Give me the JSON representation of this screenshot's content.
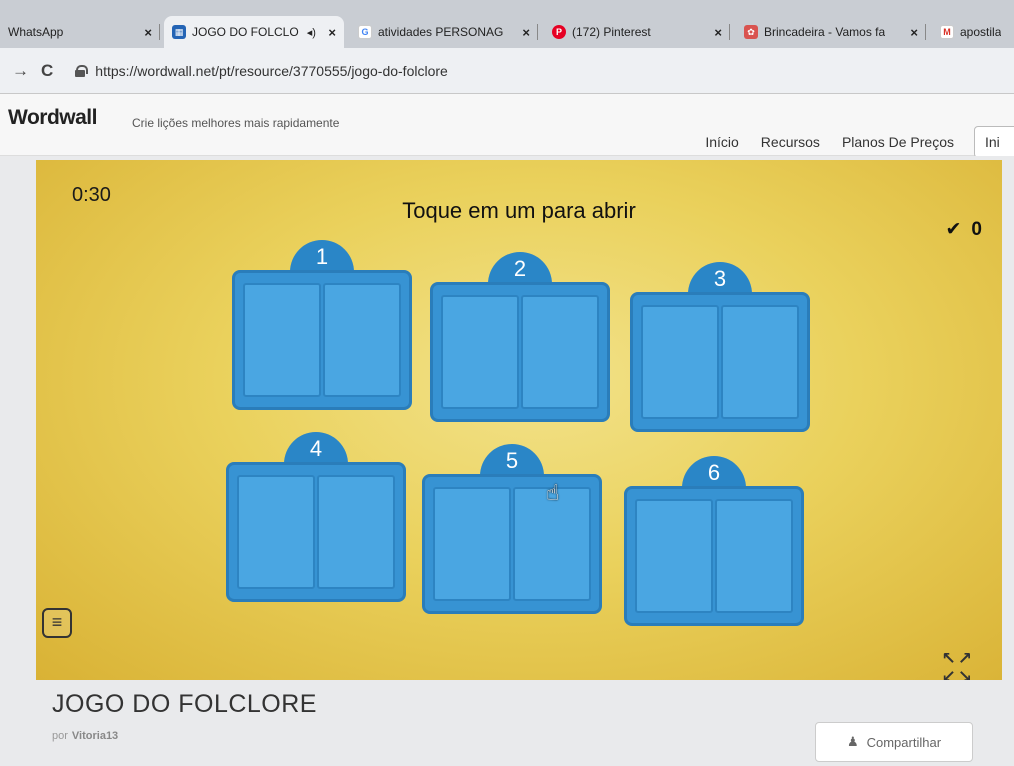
{
  "browser": {
    "tabs": [
      {
        "label": "WhatsApp",
        "icon": "whatsapp-icon",
        "active": false
      },
      {
        "label": "JOGO DO FOLCLO",
        "icon": "wordwall-icon",
        "active": true
      },
      {
        "label": "atividades PERSONAG",
        "icon": "google-icon",
        "active": false
      },
      {
        "label": "(172) Pinterest",
        "icon": "pinterest-icon",
        "active": false
      },
      {
        "label": "Brincadeira - Vamos fa",
        "icon": "site-icon",
        "active": false
      },
      {
        "label": "apostila",
        "icon": "gmail-icon",
        "active": false
      }
    ],
    "url": "https://wordwall.net/pt/resource/3770555/jogo-do-folclore"
  },
  "site": {
    "logo": "Wordwall",
    "tagline": "Crie lições melhores mais rapidamente",
    "nav": [
      "Início",
      "Recursos",
      "Planos De Preços"
    ],
    "login_label": "Ini"
  },
  "game": {
    "timer": "0:30",
    "prompt": "Toque em um para abrir",
    "score": "0",
    "boxes": [
      "1",
      "2",
      "3",
      "4",
      "5",
      "6"
    ],
    "title": "JOGO DO FOLCLORE",
    "author_prefix": "por",
    "author": "Vitoria13",
    "share_label": "Compartilhar"
  },
  "colors": {
    "game_bg": "#ead15c",
    "box_blue": "#3793d3",
    "box_tab": "#2a86c7"
  }
}
